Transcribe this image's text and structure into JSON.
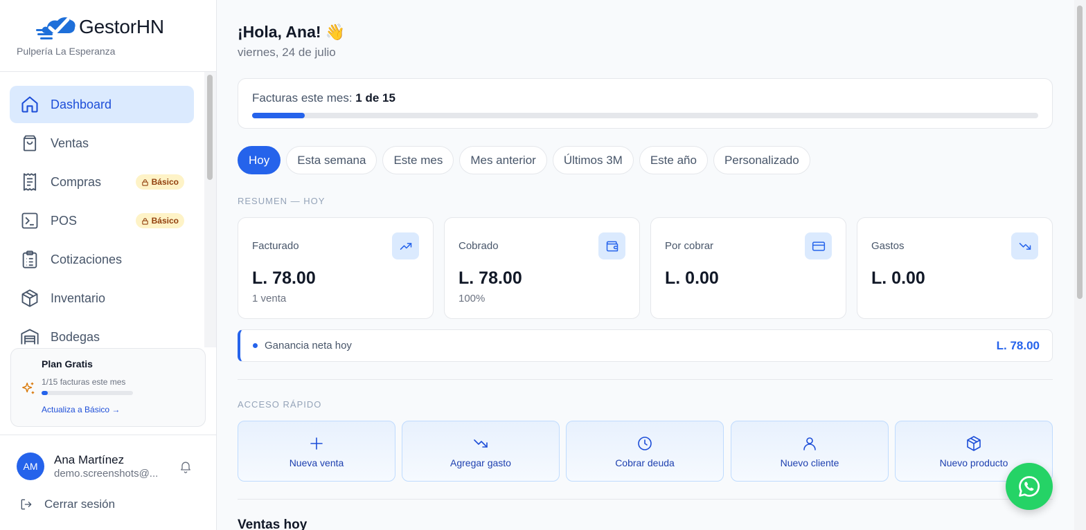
{
  "brand": {
    "name": "GestorHN",
    "business": "Pulpería La Esperanza"
  },
  "sidebar": {
    "items": [
      {
        "label": "Dashboard",
        "icon": "home-icon",
        "active": true
      },
      {
        "label": "Ventas",
        "icon": "shopping-bag-icon"
      },
      {
        "label": "Compras",
        "icon": "receipt-icon",
        "badge": "Básico"
      },
      {
        "label": "POS",
        "icon": "terminal-icon",
        "badge": "Básico"
      },
      {
        "label": "Cotizaciones",
        "icon": "clipboard-list-icon"
      },
      {
        "label": "Inventario",
        "icon": "package-icon"
      },
      {
        "label": "Bodegas",
        "icon": "warehouse-icon"
      }
    ]
  },
  "plan": {
    "title": "Plan Gratis",
    "usage": "1/15 facturas este mes",
    "usage_fraction": 0.067,
    "upgrade": "Actualiza a Básico →"
  },
  "user": {
    "initials": "AM",
    "name": "Ana Martínez",
    "email": "demo.screenshots@...",
    "logout": "Cerrar sesión"
  },
  "header": {
    "greeting": "¡Hola, Ana! 👋",
    "date": "viernes, 24 de julio"
  },
  "quota": {
    "label": "Facturas este mes: ",
    "value": "1 de 15",
    "fraction": 0.067
  },
  "tabs": [
    "Hoy",
    "Esta semana",
    "Este mes",
    "Mes anterior",
    "Últimos 3M",
    "Este año",
    "Personalizado"
  ],
  "summary": {
    "label": "RESUMEN — HOY",
    "cards": [
      {
        "title": "Facturado",
        "value": "L. 78.00",
        "sub": "1 venta",
        "icon": "trending-up-icon"
      },
      {
        "title": "Cobrado",
        "value": "L. 78.00",
        "sub": "100%",
        "icon": "wallet-icon"
      },
      {
        "title": "Por cobrar",
        "value": "L. 0.00",
        "sub": "",
        "icon": "credit-card-icon"
      },
      {
        "title": "Gastos",
        "value": "L. 0.00",
        "sub": "",
        "icon": "trending-down-icon"
      }
    ]
  },
  "profit": {
    "label": "Ganancia neta hoy",
    "value": "L. 78.00"
  },
  "quick_access": {
    "label": "ACCESO RÁPIDO",
    "items": [
      {
        "label": "Nueva venta",
        "icon": "plus-icon"
      },
      {
        "label": "Agregar gasto",
        "icon": "trending-down-icon"
      },
      {
        "label": "Cobrar deuda",
        "icon": "clock-icon"
      },
      {
        "label": "Nuevo cliente",
        "icon": "user-icon"
      },
      {
        "label": "Nuevo producto",
        "icon": "package-icon"
      }
    ]
  },
  "sales_today": {
    "title": "Ventas hoy"
  },
  "colors": {
    "accent": "#2563eb",
    "whatsapp": "#25d366",
    "badge_bg": "#fef3c7"
  }
}
